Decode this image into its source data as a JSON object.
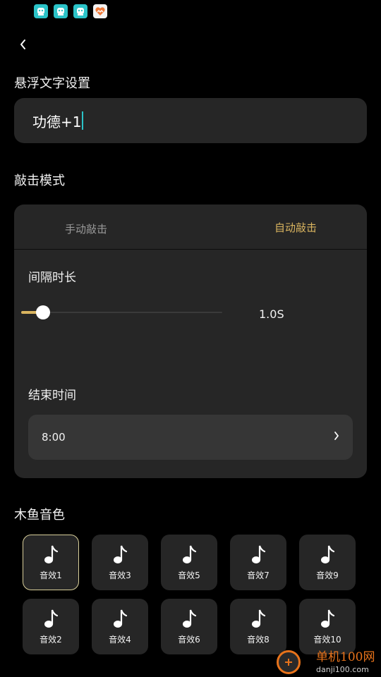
{
  "status_bar": {
    "icons": [
      "app-face-icon",
      "app-face-icon",
      "app-face-icon",
      "game-icon"
    ]
  },
  "header": {
    "back_icon": "chevron-left-icon"
  },
  "floating_text": {
    "title": "悬浮文字设置",
    "value": "功德+1"
  },
  "tap_mode": {
    "title": "敲击模式",
    "tabs": [
      {
        "label": "手动敲击",
        "active": false
      },
      {
        "label": "自动敲击",
        "active": true
      }
    ],
    "interval": {
      "label": "间隔时长",
      "value_text": "1.0S",
      "fraction": 0.11
    },
    "end_time": {
      "label": "结束时间",
      "value": "8:00"
    }
  },
  "sound": {
    "title": "木鱼音色",
    "icon": "music-note-icon",
    "items": [
      {
        "label": "音效1",
        "selected": true
      },
      {
        "label": "音效3",
        "selected": false
      },
      {
        "label": "音效5",
        "selected": false
      },
      {
        "label": "音效7",
        "selected": false
      },
      {
        "label": "音效9",
        "selected": false
      },
      {
        "label": "音效2",
        "selected": false
      },
      {
        "label": "音效4",
        "selected": false
      },
      {
        "label": "音效6",
        "selected": false
      },
      {
        "label": "音效8",
        "selected": false
      },
      {
        "label": "音效10",
        "selected": false
      }
    ]
  },
  "watermark": {
    "title": "单机100网",
    "url": "danji100.com"
  },
  "colors": {
    "background": "#000000",
    "card": "#262626",
    "accent_gold": "#d9b45f",
    "caret": "#2bc3c8"
  }
}
